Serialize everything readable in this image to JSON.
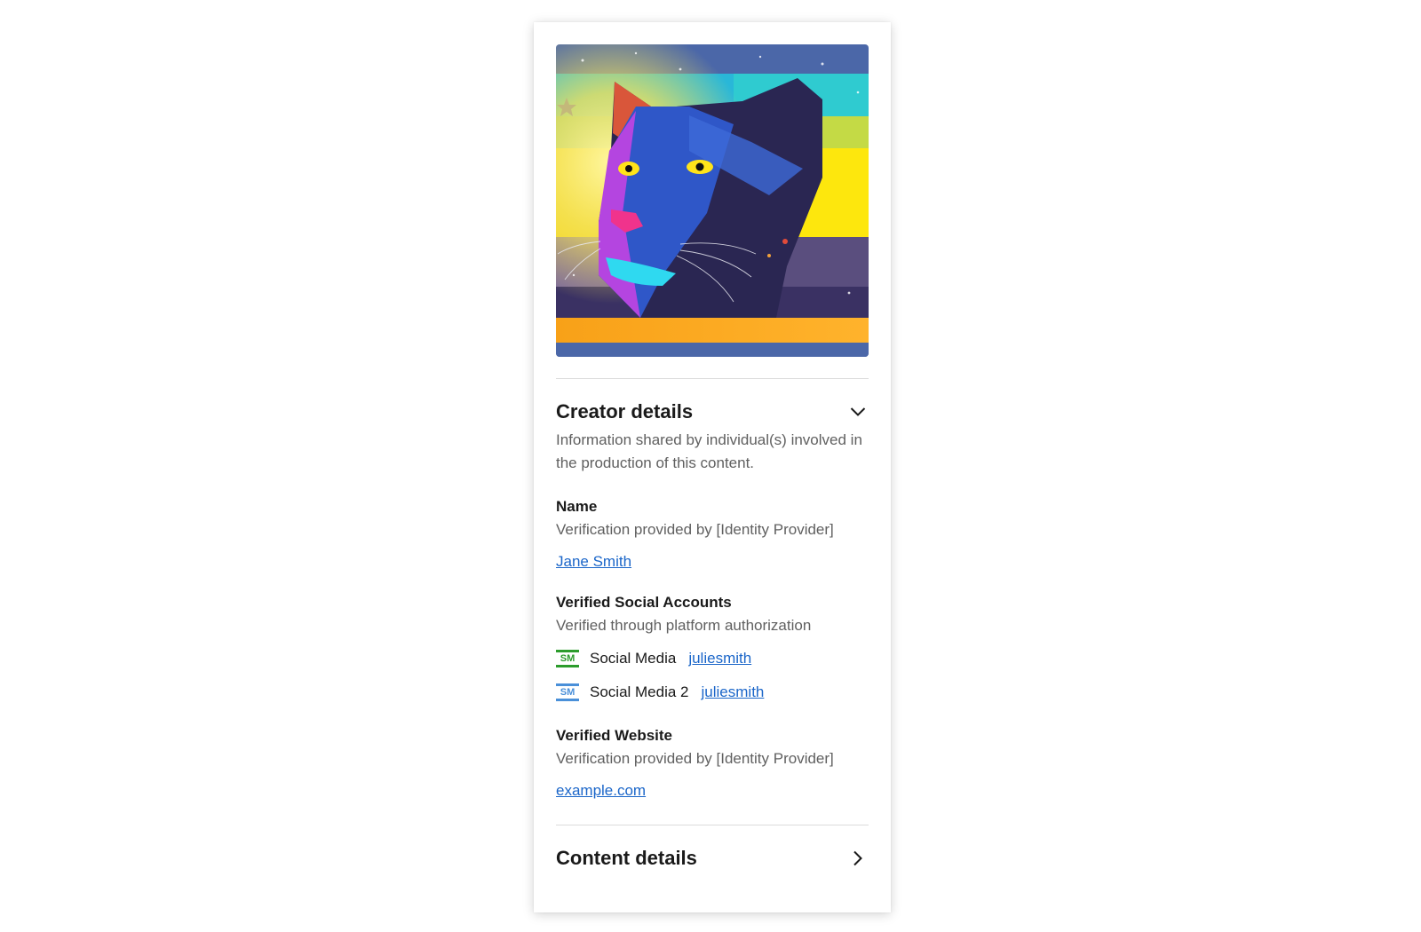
{
  "colors": {
    "accent_link": "#1b66c9",
    "sm1_badge": "#2c9c2c",
    "sm2_badge": "#4a90d9"
  },
  "artwork": {
    "icon": "panther-illustration"
  },
  "creator": {
    "title": "Creator details",
    "description": "Information shared by individual(s) involved in the production of this content.",
    "name": {
      "label": "Name",
      "verification": "Verification provided by [Identity Provider]",
      "value": "Jane Smith"
    },
    "social": {
      "label": "Verified Social Accounts",
      "verification": "Verified through platform authorization",
      "accounts": [
        {
          "badge": "SM",
          "platform": "Social Media",
          "handle": "juliesmith"
        },
        {
          "badge": "SM",
          "platform": "Social Media 2",
          "handle": "juliesmith"
        }
      ]
    },
    "website": {
      "label": "Verified Website",
      "verification": "Verification provided by [Identity Provider]",
      "value": "example.com"
    }
  },
  "content": {
    "title": "Content details"
  }
}
